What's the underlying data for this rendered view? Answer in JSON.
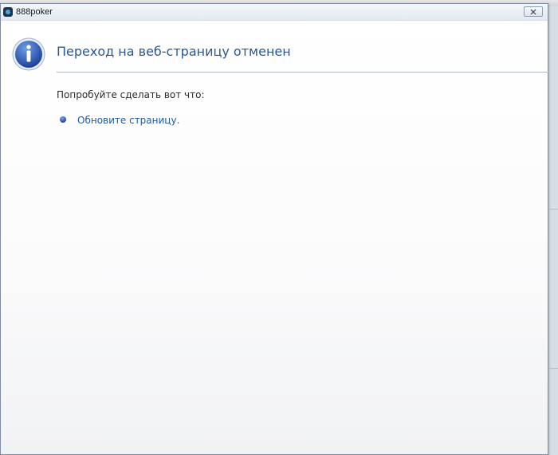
{
  "window": {
    "title": "888poker",
    "close_icon": "close-icon"
  },
  "page": {
    "heading": "Переход на веб-страницу отменен",
    "subtitle": "Попробуйте сделать вот что:",
    "suggestions": [
      {
        "label": "Обновите страницу."
      }
    ],
    "icon": "info-icon"
  },
  "colors": {
    "heading": "#2b5797",
    "link": "#1f5aa8",
    "divider": "#aeb8c6"
  }
}
